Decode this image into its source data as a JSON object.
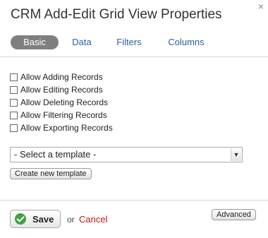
{
  "dialog": {
    "title": "CRM Add-Edit Grid View Properties",
    "close_glyph": "×"
  },
  "tabs": [
    {
      "label": "Basic",
      "active": true
    },
    {
      "label": "Data",
      "active": false
    },
    {
      "label": "Filters",
      "active": false
    },
    {
      "label": "Columns",
      "active": false
    }
  ],
  "options": [
    {
      "label": "Allow Adding Records",
      "checked": false
    },
    {
      "label": "Allow Editing Records",
      "checked": false
    },
    {
      "label": "Allow Deleting Records",
      "checked": false
    },
    {
      "label": "Allow Filtering Records",
      "checked": false
    },
    {
      "label": "Allow Exporting Records",
      "checked": false
    }
  ],
  "template": {
    "selected": "- Select a template -",
    "create_label": "Create new template"
  },
  "footer": {
    "save_label": "Save",
    "or_text": "or",
    "cancel_label": "Cancel",
    "advanced_label": "Advanced"
  },
  "colors": {
    "active_tab_bg": "#7f7f7f",
    "link": "#2a5ea8",
    "cancel": "#cc1111",
    "save_icon": "#3fa33f"
  },
  "icons": {
    "save": "checkmark-circle-icon",
    "close": "close-icon",
    "dropdown": "chevron-down-icon"
  }
}
